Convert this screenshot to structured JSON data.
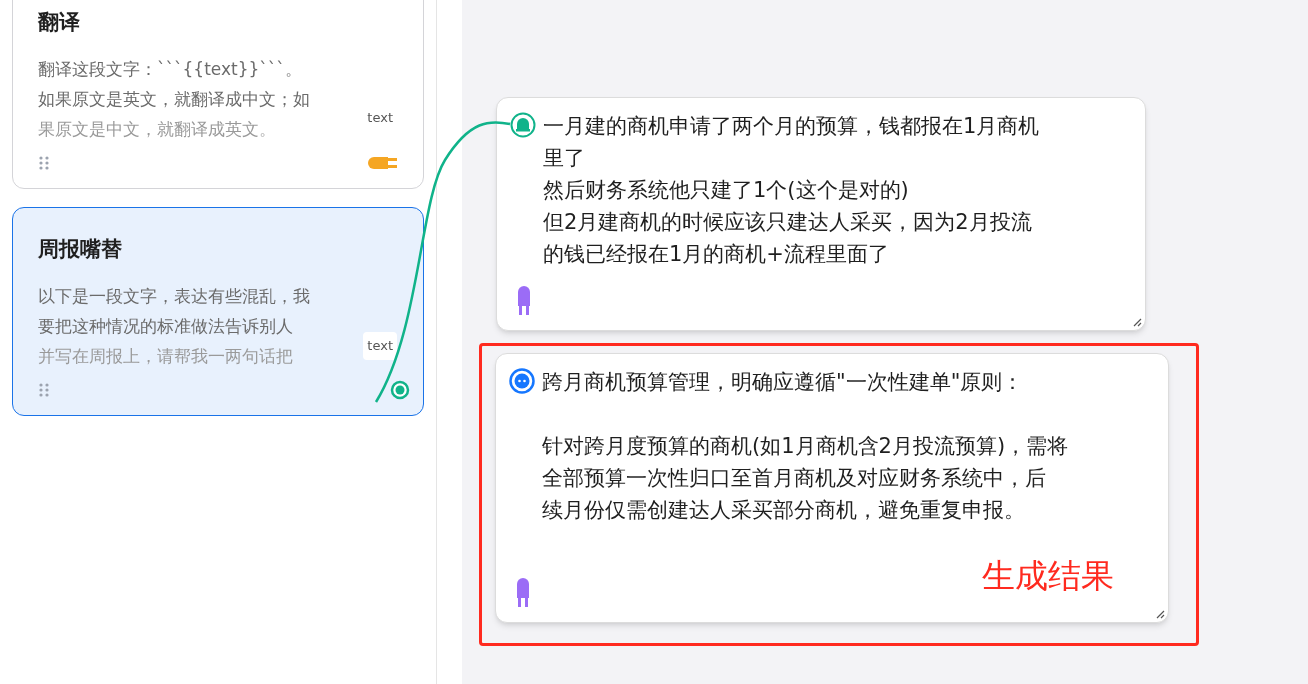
{
  "templates": [
    {
      "title": "翻译",
      "lines": [
        "翻译这段文字：```{{text}}```。",
        "如果原文是英文，就翻译成中文；如",
        "果原文是中文，就翻译成英文。"
      ],
      "selected": false,
      "port": {
        "label": "text",
        "connected": false
      }
    },
    {
      "title": "周报嘴替",
      "lines": [
        "以下是一段文字，表达有些混乱，我",
        "要把这种情况的标准做法告诉别人",
        "并写在周报上，请帮我一两句话把"
      ],
      "selected": true,
      "port": {
        "label": "text",
        "connected": true
      }
    }
  ],
  "nodes": [
    {
      "kind": "input",
      "highlighted": false,
      "paragraphs": [
        [
          "一月建的商机申请了两个月的预算，钱都报在1月商机",
          "里了",
          "然后财务系统他只建了1个(这个是对的)",
          "但2月建商机的时候应该只建达人采买，因为2月投流",
          "的钱已经报在1月的商机+流程里面了"
        ]
      ]
    },
    {
      "kind": "output",
      "highlighted": true,
      "annotation": "生成结果",
      "paragraphs": [
        [
          "跨月商机预算管理，明确应遵循\"一次性建单\"原则："
        ],
        [
          "针对跨月度预算的商机(如1月商机含2月投流预算)，需将",
          "全部预算一次性归口至首月商机及对应财务系统中，后",
          "续月份仅需创建达人采买部分商机，避免重复申报。"
        ]
      ]
    }
  ]
}
